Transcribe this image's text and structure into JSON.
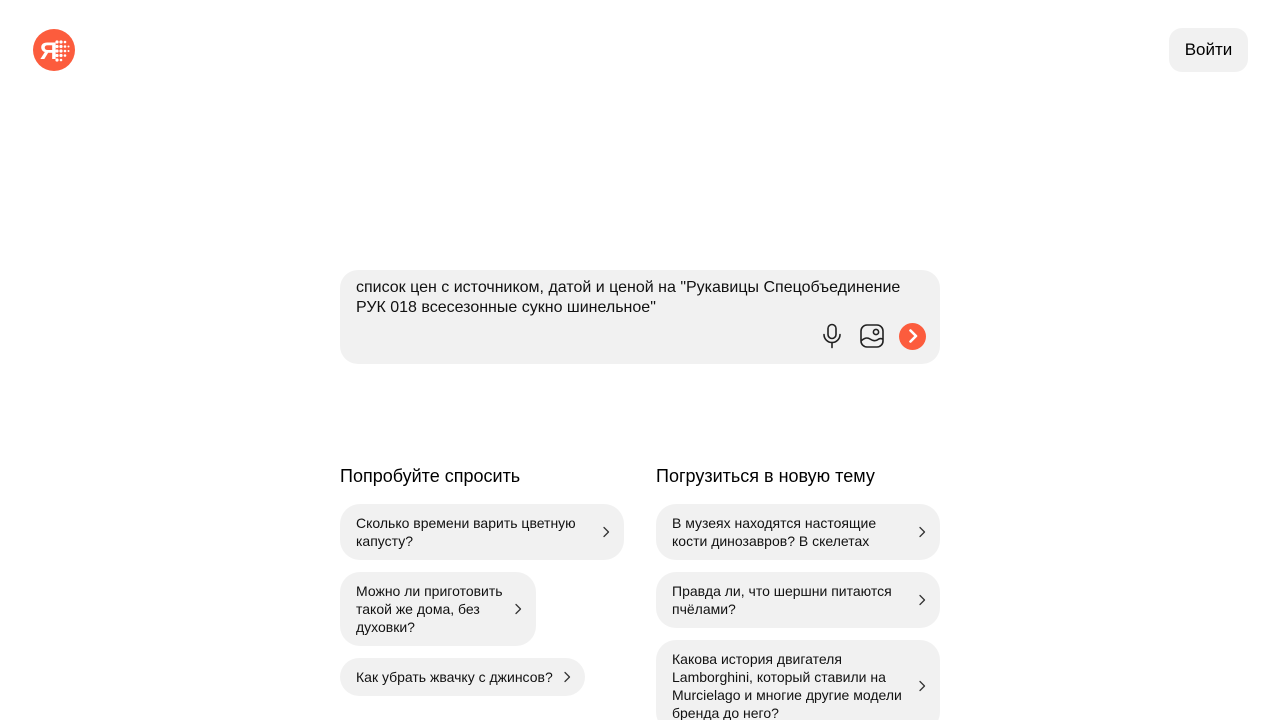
{
  "header": {
    "logo_icon": "yandex-ya-logo",
    "login_label": "Войти"
  },
  "query": {
    "text": "список цен с источником, датой и ценой на \"Рукавицы Спецобъединение РУК 018 всесезонные сукно шинельное\"",
    "icons": [
      "microphone-icon",
      "image-search-icon",
      "send-arrow-icon"
    ]
  },
  "suggest_left": {
    "title": "Попробуйте спросить",
    "items": [
      "Сколько времени варить цветную капусту?",
      "Можно ли приготовить такой же дома, без духовки?",
      "Как убрать жвачку с джинсов?"
    ]
  },
  "suggest_right": {
    "title": "Погрузиться в новую тему",
    "items": [
      "В музеях находятся настоящие кости динозавров? В скелетах",
      "Правда ли, что шершни питаются пчёлами?",
      "Какова история двигателя Lamborghini, который ставили на Murcielago и многие другие модели бренда до него?"
    ]
  },
  "colors": {
    "accent": "#fc5c3d",
    "surface": "#f1f1f1"
  }
}
